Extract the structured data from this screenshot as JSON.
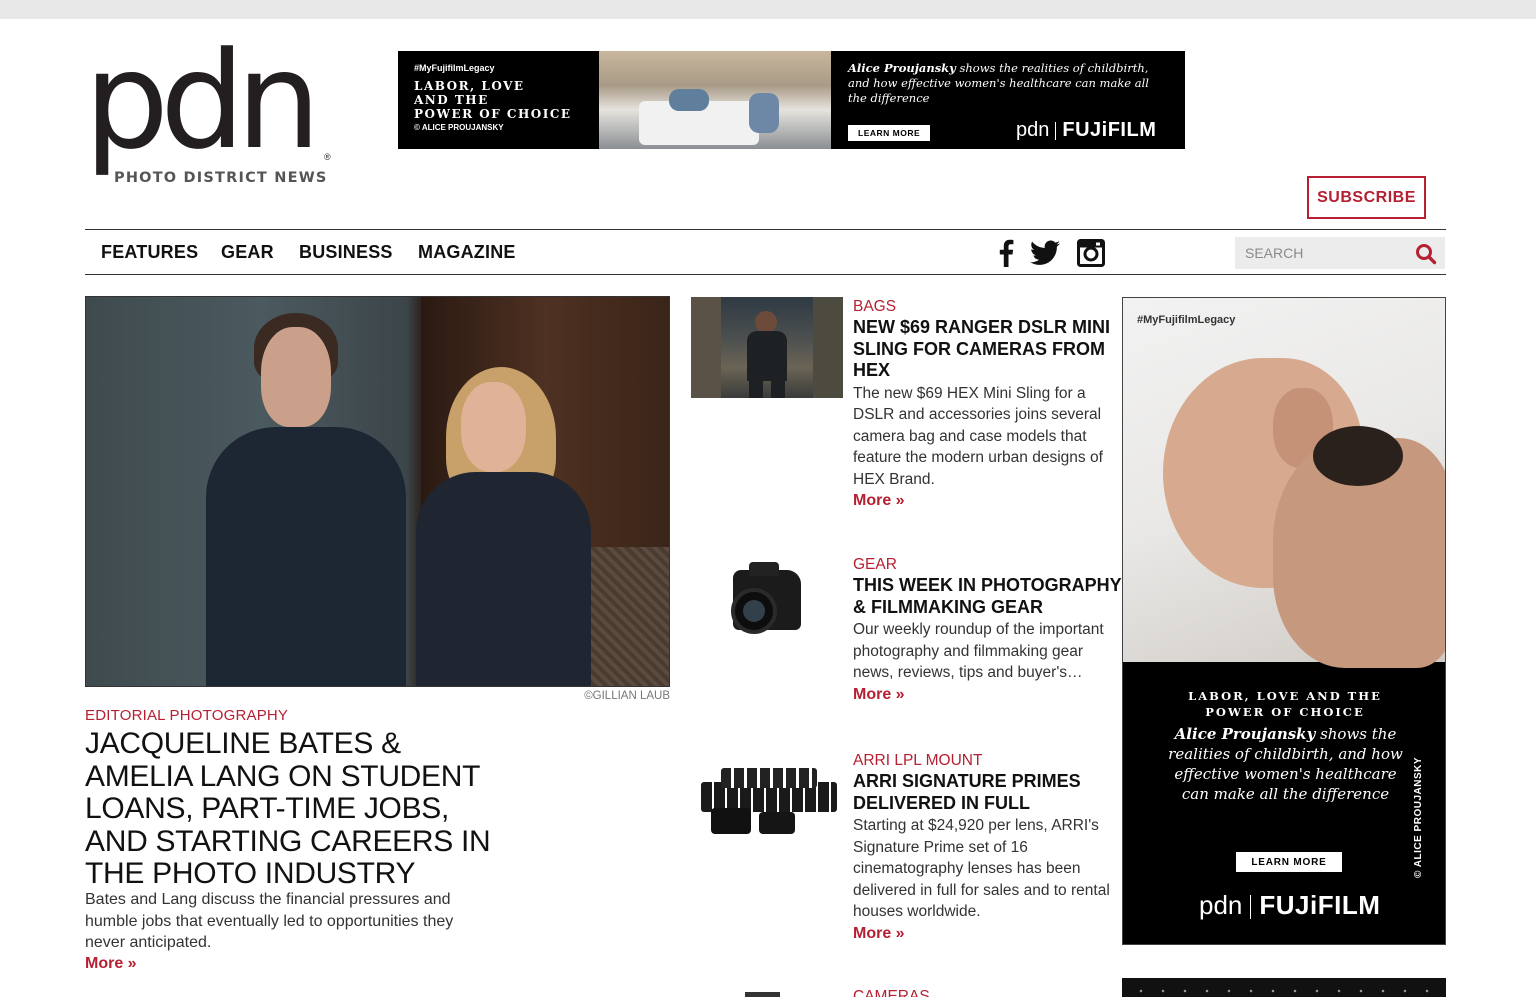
{
  "logo": {
    "wordmark": "pdn",
    "tagline": "PHOTO DISTRICT NEWS",
    "reg": "®"
  },
  "banner_ad": {
    "hashtag": "#MyFujifilmLegacy",
    "headline": "LABOR, LOVE\nAND THE\nPOWER OF CHOICE",
    "credit": "© ALICE PROUJANSKY",
    "desc_name": "Alice Proujansky",
    "desc_rest": " shows the realities of childbirth, and how effective women's healthcare can make all the difference",
    "learn_more": "LEARN MORE",
    "brand_pdn": "pdn",
    "brand_fuji": "FUJiFILM"
  },
  "subscribe_label": "SUBSCRIBE",
  "nav": {
    "items": [
      "FEATURES",
      "GEAR",
      "BUSINESS",
      "MAGAZINE"
    ],
    "social": [
      "facebook-icon",
      "twitter-icon",
      "instagram-icon"
    ],
    "search_placeholder": "SEARCH"
  },
  "feature": {
    "credit": "©GILLIAN LAUB",
    "category": "EDITORIAL PHOTOGRAPHY",
    "title": "JACQUELINE BATES & AMELIA LANG ON STUDENT LOANS, PART-TIME JOBS, AND STARTING CAREERS IN THE PHOTO INDUSTRY",
    "desc": "Bates and Lang discuss the financial pressures and humble jobs that eventually led to opportunities they never anticipated.",
    "more": "More »"
  },
  "articles": [
    {
      "category": "BAGS",
      "title": "NEW $69 RANGER DSLR MINI SLING FOR CAMERAS FROM HEX",
      "desc": "The new $69 HEX Mini Sling for a DSLR and accessories joins several camera bag and case models that feature the modern urban designs of HEX Brand.",
      "more": "More »"
    },
    {
      "category": "GEAR",
      "title": "THIS WEEK IN PHOTOGRAPHY & FILMMAKING GEAR",
      "desc": "Our weekly roundup of the important photography and filmmaking gear news, reviews, tips and buyer's…",
      "more": "More »"
    },
    {
      "category": "ARRI LPL MOUNT",
      "title": "ARRI SIGNATURE PRIMES DELIVERED IN FULL",
      "desc": "Starting at $24,920 per lens, ARRI's Signature Prime set of 16 cinematography lenses has been delivered in full for sales and to rental houses worldwide.",
      "more": "More »"
    }
  ],
  "next_category": "CAMERAS",
  "side_ad": {
    "hashtag": "#MyFujifilmLegacy",
    "headline": "LABOR, LOVE AND THE\nPOWER OF CHOICE",
    "desc_name": "Alice Proujansky",
    "desc_rest": " shows the realities of childbirth, and how effective women's healthcare can make all the difference",
    "learn_more": "LEARN MORE",
    "brand_pdn": "pdn",
    "brand_fuji": "FUJiFILM",
    "credit": "© ALICE PROUJANSKY"
  },
  "colors": {
    "accent": "#b52032",
    "text": "#111111",
    "nav_border": "#333333"
  }
}
